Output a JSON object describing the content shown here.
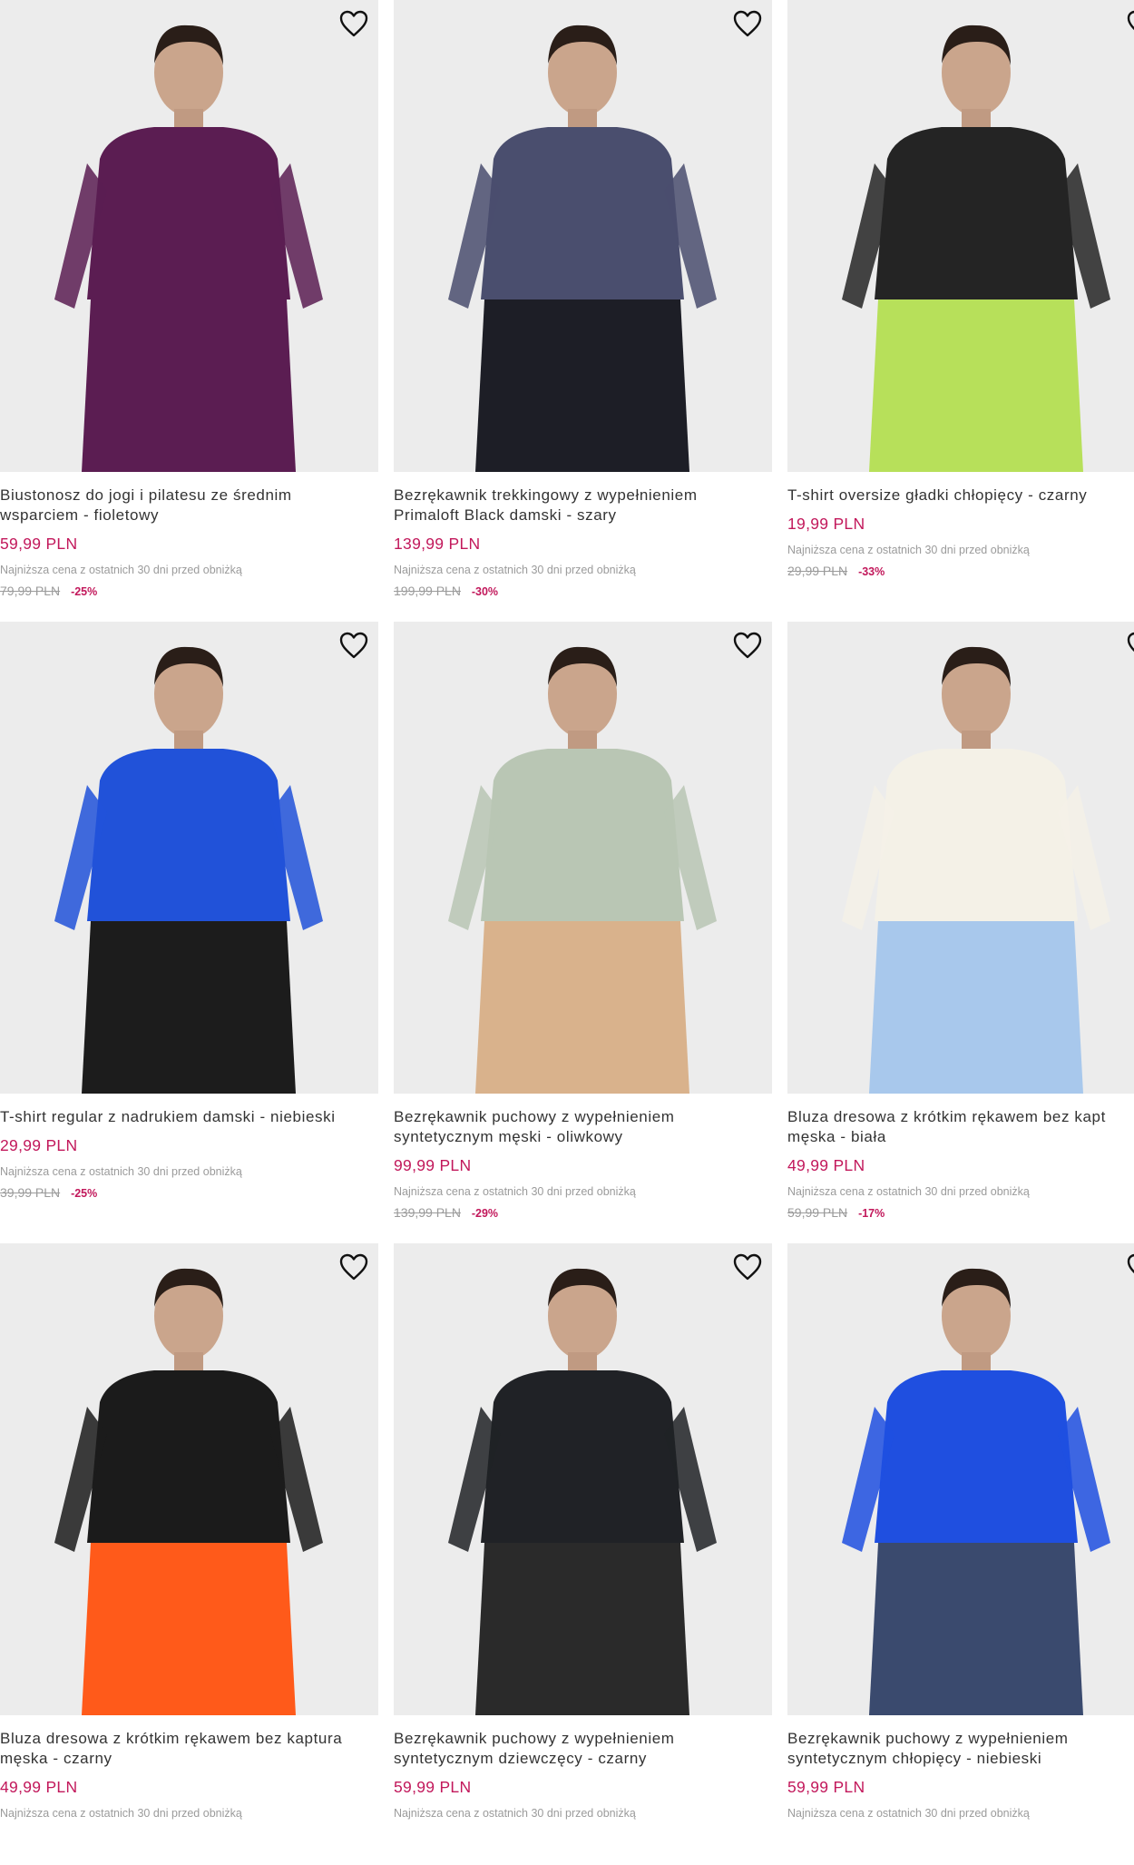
{
  "products": [
    {
      "name_line1": "Biustonosz do jogi i pilatesu ze średnim",
      "name_line2": "wsparciem - fioletowy",
      "price": "59,99 PLN",
      "lowest_label": "Najniższa cena z ostatnich 30 dni przed obniżką",
      "old_price": "79,99 PLN",
      "discount": "-25%",
      "wishlist_icon": "heart-outline-icon",
      "top_color": "#5b1d52",
      "bottom_color": "#5b1d52"
    },
    {
      "name_line1": "Bezrękawnik trekkingowy z wypełnieniem",
      "name_line2": "Primaloft Black damski - szary",
      "price": "139,99 PLN",
      "lowest_label": "Najniższa cena z ostatnich 30 dni przed obniżką",
      "old_price": "199,99 PLN",
      "discount": "-30%",
      "wishlist_icon": "heart-outline-icon",
      "top_color": "#4a4e6e",
      "bottom_color": "#1d1e26"
    },
    {
      "name_line1": "T-shirt oversize gładki chłopięcy - czarny",
      "name_line2": "",
      "price": "19,99 PLN",
      "lowest_label": "Najniższa cena z ostatnich 30 dni przed obniżką",
      "old_price": "29,99 PLN",
      "discount": "-33%",
      "wishlist_icon": "heart-outline-icon",
      "top_color": "#242424",
      "bottom_color": "#b7e05a"
    },
    {
      "name_line1": "T-shirt regular z nadrukiem damski - niebieski",
      "name_line2": "",
      "price": "29,99 PLN",
      "lowest_label": "Najniższa cena z ostatnich 30 dni przed obniżką",
      "old_price": "39,99 PLN",
      "discount": "-25%",
      "wishlist_icon": "heart-outline-icon",
      "top_color": "#2152d9",
      "bottom_color": "#1c1c1c"
    },
    {
      "name_line1": "Bezrękawnik puchowy z wypełnieniem",
      "name_line2": "syntetycznym męski - oliwkowy",
      "price": "99,99 PLN",
      "lowest_label": "Najniższa cena z ostatnich 30 dni przed obniżką",
      "old_price": "139,99 PLN",
      "discount": "-29%",
      "wishlist_icon": "heart-outline-icon",
      "top_color": "#b9c6b4",
      "bottom_color": "#d9b28c"
    },
    {
      "name_line1": "Bluza dresowa z krótkim rękawem bez kapt",
      "name_line2": "męska - biała",
      "price": "49,99 PLN",
      "lowest_label": "Najniższa cena z ostatnich 30 dni przed obniżką",
      "old_price": "59,99 PLN",
      "discount": "-17%",
      "wishlist_icon": "heart-outline-icon",
      "top_color": "#f4f1e7",
      "bottom_color": "#a8c8ec"
    },
    {
      "name_line1": "Bluza dresowa z krótkim rękawem bez kaptura",
      "name_line2": "męska - czarny",
      "price": "49,99 PLN",
      "lowest_label": "Najniższa cena z ostatnich 30 dni przed obniżką",
      "old_price": "",
      "discount": "",
      "wishlist_icon": "heart-outline-icon",
      "top_color": "#1b1b1b",
      "bottom_color": "#ff5a1a"
    },
    {
      "name_line1": "Bezrękawnik puchowy z wypełnieniem",
      "name_line2": "syntetycznym dziewczęcy - czarny",
      "price": "59,99 PLN",
      "lowest_label": "Najniższa cena z ostatnich 30 dni przed obniżką",
      "old_price": "",
      "discount": "",
      "wishlist_icon": "heart-outline-icon",
      "top_color": "#202226",
      "bottom_color": "#2a2a2a"
    },
    {
      "name_line1": "Bezrękawnik puchowy z wypełnieniem",
      "name_line2": "syntetycznym chłopięcy - niebieski",
      "price": "59,99 PLN",
      "lowest_label": "Najniższa cena z ostatnich 30 dni przed obniżką",
      "old_price": "",
      "discount": "",
      "wishlist_icon": "heart-outline-icon",
      "top_color": "#1f4fe0",
      "bottom_color": "#3a4a6e"
    }
  ]
}
